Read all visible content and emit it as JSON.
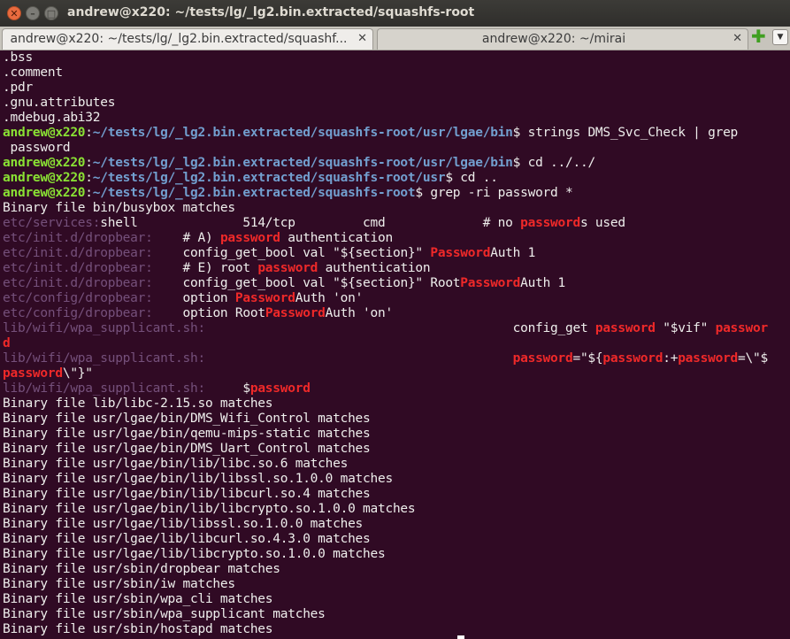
{
  "window": {
    "title": "andrew@x220: ~/tests/lg/_lg2.bin.extracted/squashfs-root",
    "close_glyph": "✕",
    "minimize_glyph": "–",
    "maximize_glyph": "□"
  },
  "tabs": [
    {
      "label": "andrew@x220: ~/tests/lg/_lg2.bin.extracted/squashf...",
      "close": "✕"
    },
    {
      "label": "andrew@x220: ~/mirai",
      "close": "✕"
    }
  ],
  "tabbar": {
    "new_tab_glyph": "✚",
    "menu_glyph": "▼"
  },
  "colors": {
    "background": "#300a24",
    "prompt_user": "#8ae234",
    "prompt_path": "#729fcf",
    "filename": "#75507b",
    "match": "#ef2929",
    "text": "#eeeeec"
  },
  "terminal": {
    "lines": [
      [
        {
          "t": ".bss"
        }
      ],
      [
        {
          "t": ".comment"
        }
      ],
      [
        {
          "t": ".pdr"
        }
      ],
      [
        {
          "t": ".gnu.attributes"
        }
      ],
      [
        {
          "t": ".mdebug.abi32"
        }
      ],
      [
        {
          "t": "andrew@x220",
          "c": "p-user"
        },
        {
          "t": ":"
        },
        {
          "t": "~/tests/lg/_lg2.bin.extracted/squashfs-root/usr/lgae/bin",
          "c": "p-path"
        },
        {
          "t": "$ strings DMS_Svc_Check | grep"
        }
      ],
      [
        {
          "t": " password"
        }
      ],
      [
        {
          "t": "andrew@x220",
          "c": "p-user"
        },
        {
          "t": ":"
        },
        {
          "t": "~/tests/lg/_lg2.bin.extracted/squashfs-root/usr/lgae/bin",
          "c": "p-path"
        },
        {
          "t": "$ cd ../../"
        }
      ],
      [
        {
          "t": "andrew@x220",
          "c": "p-user"
        },
        {
          "t": ":"
        },
        {
          "t": "~/tests/lg/_lg2.bin.extracted/squashfs-root/usr",
          "c": "p-path"
        },
        {
          "t": "$ cd .."
        }
      ],
      [
        {
          "t": "andrew@x220",
          "c": "p-user"
        },
        {
          "t": ":"
        },
        {
          "t": "~/tests/lg/_lg2.bin.extracted/squashfs-root",
          "c": "p-path"
        },
        {
          "t": "$ grep -ri password *"
        }
      ],
      [
        {
          "t": "Binary file bin/busybox matches"
        }
      ],
      [
        {
          "t": "etc/services:",
          "c": "fn"
        },
        {
          "t": "shell              514/tcp         cmd             # no "
        },
        {
          "t": "password",
          "c": "hl"
        },
        {
          "t": "s used"
        }
      ],
      [
        {
          "t": "etc/init.d/dropbear:",
          "c": "fn"
        },
        {
          "t": "    # A) "
        },
        {
          "t": "password",
          "c": "hl"
        },
        {
          "t": " authentication"
        }
      ],
      [
        {
          "t": "etc/init.d/dropbear:",
          "c": "fn"
        },
        {
          "t": "    config_get_bool val \"${section}\" "
        },
        {
          "t": "Password",
          "c": "hl"
        },
        {
          "t": "Auth 1"
        }
      ],
      [
        {
          "t": "etc/init.d/dropbear:",
          "c": "fn"
        },
        {
          "t": "    # E) root "
        },
        {
          "t": "password",
          "c": "hl"
        },
        {
          "t": " authentication"
        }
      ],
      [
        {
          "t": "etc/init.d/dropbear:",
          "c": "fn"
        },
        {
          "t": "    config_get_bool val \"${section}\" Root"
        },
        {
          "t": "Password",
          "c": "hl"
        },
        {
          "t": "Auth 1"
        }
      ],
      [
        {
          "t": "etc/config/dropbear:",
          "c": "fn"
        },
        {
          "t": "    option "
        },
        {
          "t": "Password",
          "c": "hl"
        },
        {
          "t": "Auth 'on'"
        }
      ],
      [
        {
          "t": "etc/config/dropbear:",
          "c": "fn"
        },
        {
          "t": "    option Root"
        },
        {
          "t": "Password",
          "c": "hl"
        },
        {
          "t": "Auth 'on'"
        }
      ],
      [
        {
          "t": "lib/wifi/wpa_supplicant.sh:",
          "c": "fn"
        },
        {
          "t": "                                         config_get "
        },
        {
          "t": "password",
          "c": "hl"
        },
        {
          "t": " \"$vif\" "
        },
        {
          "t": "passwor",
          "c": "hl"
        }
      ],
      [
        {
          "t": "d",
          "c": "hl"
        }
      ],
      [
        {
          "t": "lib/wifi/wpa_supplicant.sh:",
          "c": "fn"
        },
        {
          "t": "                                         "
        },
        {
          "t": "password",
          "c": "hl"
        },
        {
          "t": "=\"${"
        },
        {
          "t": "password",
          "c": "hl"
        },
        {
          "t": ":+"
        },
        {
          "t": "password",
          "c": "hl"
        },
        {
          "t": "=\\\"$"
        }
      ],
      [
        {
          "t": "password",
          "c": "hl"
        },
        {
          "t": "\\\"}\""
        }
      ],
      [
        {
          "t": "lib/wifi/wpa_supplicant.sh:",
          "c": "fn"
        },
        {
          "t": "     $"
        },
        {
          "t": "password",
          "c": "hl"
        }
      ],
      [
        {
          "t": "Binary file lib/libc-2.15.so matches"
        }
      ],
      [
        {
          "t": "Binary file usr/lgae/bin/DMS_Wifi_Control matches"
        }
      ],
      [
        {
          "t": "Binary file usr/lgae/bin/qemu-mips-static matches"
        }
      ],
      [
        {
          "t": "Binary file usr/lgae/bin/DMS_Uart_Control matches"
        }
      ],
      [
        {
          "t": "Binary file usr/lgae/bin/lib/libc.so.6 matches"
        }
      ],
      [
        {
          "t": "Binary file usr/lgae/bin/lib/libssl.so.1.0.0 matches"
        }
      ],
      [
        {
          "t": "Binary file usr/lgae/bin/lib/libcurl.so.4 matches"
        }
      ],
      [
        {
          "t": "Binary file usr/lgae/bin/lib/libcrypto.so.1.0.0 matches"
        }
      ],
      [
        {
          "t": "Binary file usr/lgae/lib/libssl.so.1.0.0 matches"
        }
      ],
      [
        {
          "t": "Binary file usr/lgae/lib/libcurl.so.4.3.0 matches"
        }
      ],
      [
        {
          "t": "Binary file usr/lgae/lib/libcrypto.so.1.0.0 matches"
        }
      ],
      [
        {
          "t": "Binary file usr/sbin/dropbear matches"
        }
      ],
      [
        {
          "t": "Binary file usr/sbin/iw matches"
        }
      ],
      [
        {
          "t": "Binary file usr/sbin/wpa_cli matches"
        }
      ],
      [
        {
          "t": "Binary file usr/sbin/wpa_supplicant matches"
        }
      ],
      [
        {
          "t": "Binary file usr/sbin/hostapd matches"
        }
      ]
    ]
  }
}
